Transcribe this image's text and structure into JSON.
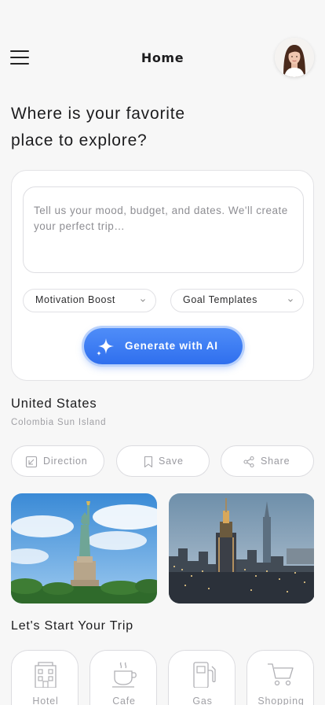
{
  "header": {
    "title": "Home",
    "menu_icon": "hamburger-menu-icon",
    "avatar": "user-avatar"
  },
  "headline": {
    "line1": "Where is your favorite",
    "line2": "place to explore?"
  },
  "ai_card": {
    "prompt_placeholder": "Tell us your mood, budget, and dates. We'll create your perfect trip…",
    "select_motivation": "Motivation Boost",
    "select_goal": "Goal Templates",
    "generate_label": "Generate with AI",
    "generate_icon": "sparkle-icon",
    "accent": "#3a7bf2"
  },
  "location": {
    "title": "United States",
    "subtitle": "Colombia Sun Island"
  },
  "actions": {
    "direction": "Direction",
    "save": "Save",
    "share": "Share"
  },
  "photos": [
    {
      "subject": "statue-of-liberty-photo"
    },
    {
      "subject": "new-york-skyline-photo"
    }
  ],
  "trip": {
    "title": "Let's Start Your Trip",
    "categories": [
      {
        "label": "Hotel",
        "icon": "hotel-icon"
      },
      {
        "label": "Cafe",
        "icon": "coffee-cup-icon"
      },
      {
        "label": "Gas",
        "icon": "gas-pump-icon"
      },
      {
        "label": "Shopping",
        "icon": "shopping-cart-icon"
      }
    ]
  }
}
